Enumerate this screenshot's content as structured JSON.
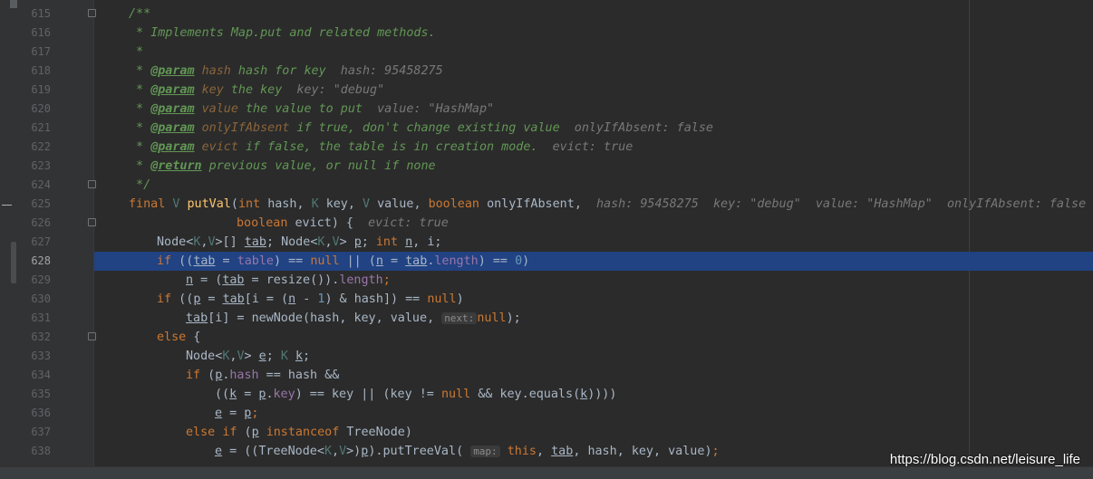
{
  "watermark": "https://blog.csdn.net/leisure_life",
  "lines": {
    "l615": {
      "n": "615",
      "t1": "/**"
    },
    "l616": {
      "n": "616",
      "t1": " * Implements Map.put and related methods."
    },
    "l617": {
      "n": "617",
      "t1": " *"
    },
    "l618": {
      "n": "618",
      "t1": " * ",
      "tag": "@param",
      "sp": " ",
      "p": "hash",
      "t2": " hash for key",
      "hint": "  hash: 95458275"
    },
    "l619": {
      "n": "619",
      "t1": " * ",
      "tag": "@param",
      "sp": " ",
      "p": "key",
      "t2": " the key",
      "hint": "  key: \"debug\""
    },
    "l620": {
      "n": "620",
      "t1": " * ",
      "tag": "@param",
      "sp": " ",
      "p": "value",
      "t2": " the value to put",
      "hint": "  value: \"HashMap\""
    },
    "l621": {
      "n": "621",
      "t1": " * ",
      "tag": "@param",
      "sp": " ",
      "p": "onlyIfAbsent",
      "t2": " if true, don't change existing value",
      "hint": "  onlyIfAbsent: false"
    },
    "l622": {
      "n": "622",
      "t1": " * ",
      "tag": "@param",
      "sp": " ",
      "p": "evict",
      "t2": " if false, the table is in creation mode.",
      "hint": "  evict: true"
    },
    "l623": {
      "n": "623",
      "t1": " * ",
      "tag": "@return",
      "t2": " previous value, or null if none"
    },
    "l624": {
      "n": "624",
      "t1": " */"
    },
    "l625": {
      "n": "625",
      "hint": "  hash: 95458275  key: \"debug\"  value: \"HashMap\"  onlyIfAbsent: false"
    },
    "l626": {
      "n": "626",
      "hint": "  evict: true"
    },
    "l627": {
      "n": "627"
    },
    "l628": {
      "n": "628"
    },
    "l629": {
      "n": "629"
    },
    "l630": {
      "n": "630"
    },
    "l631": {
      "n": "631",
      "hint": "next:"
    },
    "l632": {
      "n": "632"
    },
    "l633": {
      "n": "633"
    },
    "l634": {
      "n": "634"
    },
    "l635": {
      "n": "635"
    },
    "l636": {
      "n": "636"
    },
    "l637": {
      "n": "637"
    },
    "l638": {
      "n": "638",
      "hint": "map:"
    }
  },
  "tok": {
    "final": "final",
    "V": "V",
    "K": "K",
    "putVal": "putVal",
    "int": "int",
    "boolean": "boolean",
    "hash": "hash",
    "key": "key",
    "value": "value",
    "onlyIfAbsent": "onlyIfAbsent",
    "evict": "evict",
    "Node": "Node",
    "tab": "tab",
    "p": "p",
    "n": "n",
    "i": "i",
    "e": "e",
    "k": "k",
    "if": "if",
    "else": "else",
    "table": "table",
    "null": "null",
    "length": "length",
    "zero": "0",
    "one": "1",
    "resize": "resize",
    "newNode": "newNode",
    "instanceof": "instanceof",
    "TreeNode": "TreeNode",
    "putTreeVal": "putTreeVal",
    "this": "this",
    "equals": "equals"
  },
  "colors": {
    "background": "#2b2b2b",
    "gutter": "#313335",
    "selection": "#214283",
    "comment": "#629755",
    "keyword": "#cc7832",
    "method": "#ffc66d",
    "number": "#6897bb",
    "field": "#9876aa"
  }
}
